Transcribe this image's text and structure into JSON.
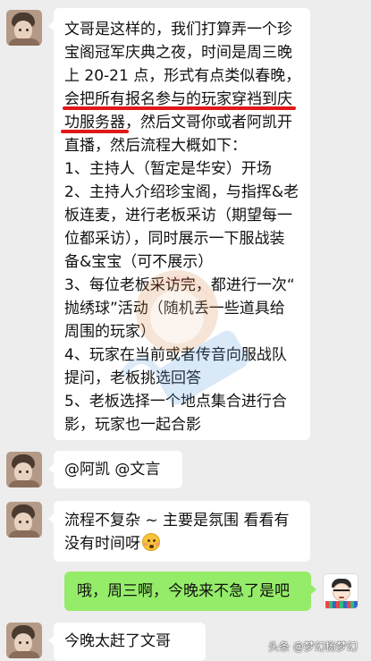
{
  "messages": [
    {
      "sender": "other",
      "avatar": "child-photo-avatar",
      "lines": [
        "文哥是这样的，我们打算弄一个珍",
        "宝阁冠军庆典之夜，时间是周三晚",
        "上 20-21 点，形式有点类似春晚，",
        "会把所有报名参与的玩家穿裆到庆",
        "功服务器，然后文哥你或者阿凯开",
        "直播，然后流程大概如下：",
        "1、主持人（暂定是华安）开场",
        "2、主持人介绍珍宝阁，与指挥&老",
        "板连麦，进行老板采访（期望每一",
        "位都采访），同时展示一下服战装",
        "备&宝宝（可不展示）",
        "3、每位老板采访完，都进行一次“",
        "抛绣球”活动（随机丢一些道具给",
        "周围的玩家）",
        "4、玩家在当前或者传音向服战队",
        "提问，老板挑选回答",
        "5、老板选择一个地点集合进行合",
        "影，玩家也一起合影"
      ],
      "underlined_lines": [
        "会把所有报名参与的玩家穿裆到庆",
        "功服务器"
      ],
      "underline_color": "#e01818"
    },
    {
      "sender": "other",
      "avatar": "child-photo-avatar",
      "text": "@阿凯  @文言"
    },
    {
      "sender": "other",
      "avatar": "child-photo-avatar",
      "lines": [
        "流程不复杂 ~ 主要是氛围 看看有",
        "没有时间呀"
      ],
      "emoji": "blushing-face-emoji"
    },
    {
      "sender": "me",
      "avatar": "cartoon-glasses-avatar",
      "text": "哦，周三啊，今晚来不急了是吧"
    },
    {
      "sender": "other",
      "avatar": "child-photo-avatar",
      "text": "今晚太赶了文哥"
    }
  ],
  "line4_rest": "，然后文哥你或者阿凯开",
  "watermark": {
    "text": "头条 @梦幻杨梦幻"
  },
  "colors": {
    "background": "#ededed",
    "incoming_bubble": "#ffffff",
    "outgoing_bubble": "#95ec69"
  }
}
